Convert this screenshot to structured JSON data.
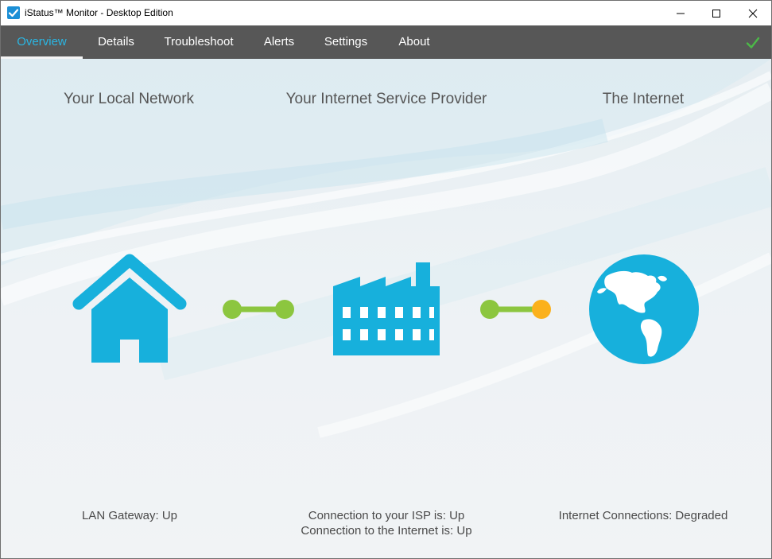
{
  "window": {
    "title": "iStatus™ Monitor - Desktop Edition",
    "controls": {
      "minimize": "minimize-icon",
      "maximize": "maximize-icon",
      "close": "close-icon"
    }
  },
  "nav": {
    "tabs": [
      {
        "label": "Overview",
        "active": true
      },
      {
        "label": "Details",
        "active": false
      },
      {
        "label": "Troubleshoot",
        "active": false
      },
      {
        "label": "Alerts",
        "active": false
      },
      {
        "label": "Settings",
        "active": false
      },
      {
        "label": "About",
        "active": false
      }
    ],
    "status_icon": "checkmark-icon"
  },
  "overview": {
    "local": {
      "title": "Your Local Network",
      "icon": "house-icon",
      "status": "LAN Gateway: Up"
    },
    "isp": {
      "title": "Your Internet Service Provider",
      "icon": "factory-icon",
      "status_lines": [
        "Connection to your ISP is: Up",
        "Connection to the Internet is: Up"
      ]
    },
    "internet": {
      "title": "The Internet",
      "icon": "globe-icon",
      "status": "Internet Connections: Degraded"
    },
    "links": [
      {
        "from": "local",
        "to": "isp",
        "state": "up"
      },
      {
        "from": "isp",
        "to": "internet",
        "state": "degraded"
      }
    ]
  },
  "colors": {
    "accent": "#2ab6e3",
    "icon": "#17b0dc",
    "link_ok": "#8cc63f",
    "link_warn": "#fbb11c",
    "navbar": "#575757",
    "check": "#4cb848"
  }
}
